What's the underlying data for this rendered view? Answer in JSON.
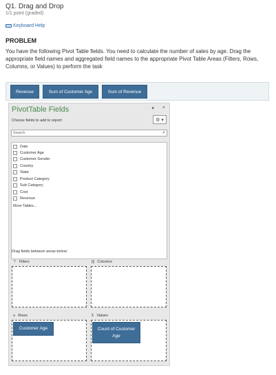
{
  "question": {
    "title": "Q1. Drag and Drop",
    "points": "1/1 point (graded)",
    "keyboard_help": "Keyboard Help",
    "problem_heading": "PROBLEM",
    "problem_text": "You have the following Pivot Table fields. You need to calculate the number of sales by age. Drag the appropriate field names and aggregated field names to the appropriate Pivot Table Areas (Filters, Rows, Columns, or Values) to perform the task"
  },
  "draggables": [
    {
      "label": "Revenue"
    },
    {
      "label": "Sum of Customer Age"
    },
    {
      "label": "Sum of Revenue"
    }
  ],
  "pivot_pane": {
    "title": "PivotTable Fields",
    "dropdown_glyph": "▾",
    "close_glyph": "×",
    "choose_label": "Choose fields to add to report:",
    "gear_glyph": "⚙ ▾",
    "search_placeholder": "Search",
    "search_glyph": "⌕",
    "fields": [
      {
        "label": "Date"
      },
      {
        "label": "Customer Age"
      },
      {
        "label": "Customer Gender"
      },
      {
        "label": "Country"
      },
      {
        "label": "State"
      },
      {
        "label": "Product Category"
      },
      {
        "label": "Sub Category"
      },
      {
        "label": "Cost"
      },
      {
        "label": "Revenue"
      }
    ],
    "more_tables": "More Tables...",
    "drag_hint": "Drag fields between areas below:",
    "areas": {
      "filters": {
        "label": "Filters",
        "glyph": "⊤"
      },
      "columns": {
        "label": "Columns",
        "glyph": "|||"
      },
      "rows": {
        "label": "Rows",
        "glyph": "≡"
      },
      "values": {
        "label": "Values",
        "glyph": "Σ"
      }
    },
    "rows_item": "Customer Age",
    "values_item": "Count of Customer Age"
  },
  "colors": {
    "chip": "#3e6d98",
    "pane_title": "#4c8a4f",
    "link": "#2a6aa8"
  }
}
